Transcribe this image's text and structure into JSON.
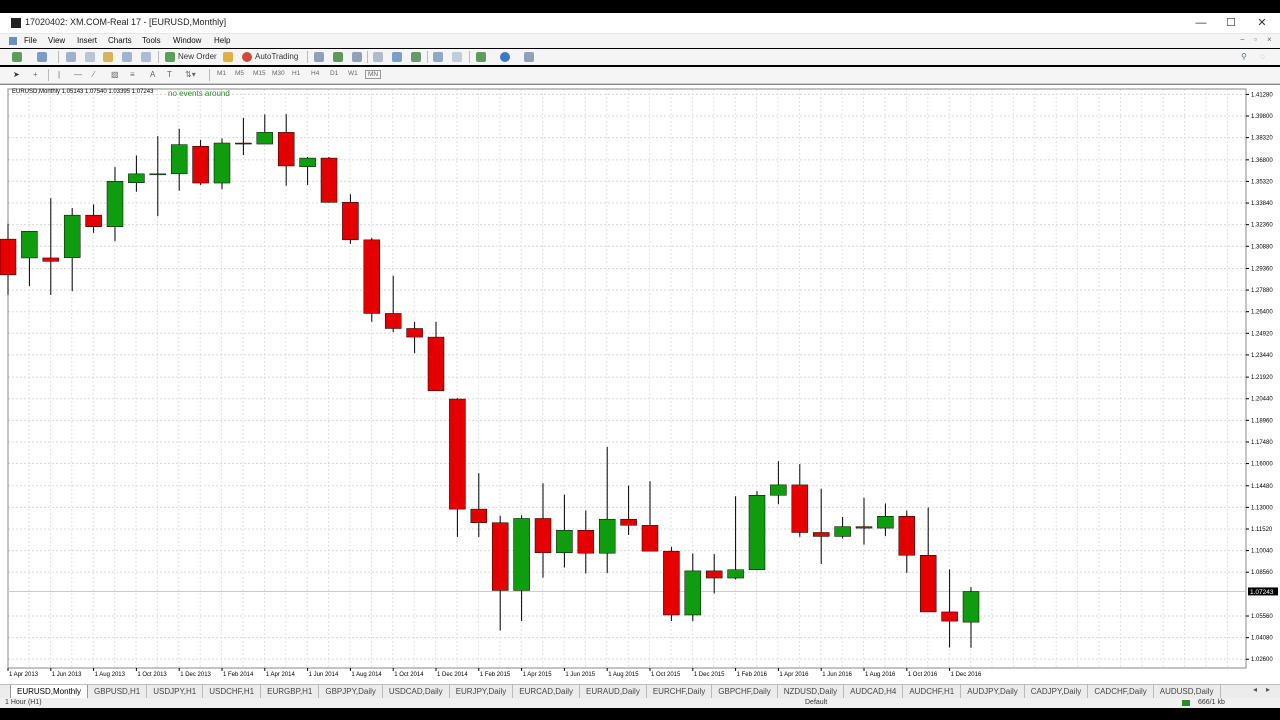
{
  "window": {
    "title": "17020402: XM.COM-Real 17 - [EURUSD,Monthly]",
    "minimize": "—",
    "maximize": "☐",
    "close": "✕"
  },
  "menu": {
    "items": [
      "File",
      "View",
      "Insert",
      "Charts",
      "Tools",
      "Window",
      "Help"
    ]
  },
  "toolbar": {
    "new_order": "New Order",
    "autotrading": "AutoTrading",
    "timeframes": [
      "M1",
      "M5",
      "M15",
      "M30",
      "H1",
      "H4",
      "D1",
      "W1",
      "MN"
    ]
  },
  "chart": {
    "info": "EURUSD,Monthly  1.05143 1.07540 1.03395 1.07243",
    "events": "no events around",
    "current_price": "1.07243",
    "up_color": "#0f9d0f",
    "down_color": "#e50000"
  },
  "chart_data": {
    "type": "candlestick",
    "symbol": "EURUSD",
    "timeframe": "Monthly",
    "x_tick_labels": [
      "1 Apr 2013",
      "1 Jun 2013",
      "1 Aug 2013",
      "1 Oct 2013",
      "1 Dec 2013",
      "1 Feb 2014",
      "1 Apr 2014",
      "1 Jun 2014",
      "1 Aug 2014",
      "1 Oct 2014",
      "1 Dec 2014",
      "1 Feb 2015",
      "1 Apr 2015",
      "1 Jun 2015",
      "1 Aug 2015",
      "1 Oct 2015",
      "1 Dec 2015",
      "1 Feb 2016",
      "1 Apr 2016",
      "1 Jun 2016",
      "1 Aug 2016",
      "1 Oct 2016",
      "1 Dec 2016"
    ],
    "y_tick_labels": [
      "1.41280",
      "1.39800",
      "1.38320",
      "1.36800",
      "1.35320",
      "1.33840",
      "1.32360",
      "1.30880",
      "1.29360",
      "1.27880",
      "1.26400",
      "1.24920",
      "1.23440",
      "1.21920",
      "1.20440",
      "1.18960",
      "1.17480",
      "1.16000",
      "1.14480",
      "1.13000",
      "1.11520",
      "1.10040",
      "1.08560",
      "1.07243",
      "1.05560",
      "1.04080",
      "1.02600"
    ],
    "y_ticks": [
      1.4128,
      1.398,
      1.3832,
      1.368,
      1.3532,
      1.3384,
      1.3236,
      1.3088,
      1.2936,
      1.2788,
      1.264,
      1.2492,
      1.2344,
      1.2192,
      1.2044,
      1.1896,
      1.1748,
      1.16,
      1.1448,
      1.13,
      1.1152,
      1.1004,
      1.0856,
      1.0556,
      1.0408,
      1.026
    ],
    "ylim": [
      1.02,
      1.4165
    ],
    "current_price": 1.07243,
    "candles": [
      {
        "o": 1.3137,
        "h": 1.3242,
        "l": 1.2756,
        "c": 1.2892
      },
      {
        "o": 1.3008,
        "h": 1.3111,
        "l": 1.2815,
        "c": 1.3191
      },
      {
        "o": 1.3008,
        "h": 1.3417,
        "l": 1.2755,
        "c": 1.2985
      },
      {
        "o": 1.301,
        "h": 1.335,
        "l": 1.278,
        "c": 1.3301
      },
      {
        "o": 1.3301,
        "h": 1.3375,
        "l": 1.318,
        "c": 1.3222
      },
      {
        "o": 1.3222,
        "h": 1.363,
        "l": 1.3123,
        "c": 1.3533
      },
      {
        "o": 1.3523,
        "h": 1.371,
        "l": 1.3462,
        "c": 1.3584
      },
      {
        "o": 1.3584,
        "h": 1.3842,
        "l": 1.3294,
        "c": 1.3584
      },
      {
        "o": 1.3584,
        "h": 1.3893,
        "l": 1.3468,
        "c": 1.3784
      },
      {
        "o": 1.3773,
        "h": 1.3817,
        "l": 1.3508,
        "c": 1.3521
      },
      {
        "o": 1.3521,
        "h": 1.3827,
        "l": 1.3479,
        "c": 1.3795
      },
      {
        "o": 1.3795,
        "h": 1.3967,
        "l": 1.3713,
        "c": 1.3788
      },
      {
        "o": 1.3788,
        "h": 1.3991,
        "l": 1.379,
        "c": 1.3868
      },
      {
        "o": 1.3868,
        "h": 1.3993,
        "l": 1.3503,
        "c": 1.3638
      },
      {
        "o": 1.3633,
        "h": 1.37,
        "l": 1.3508,
        "c": 1.3692
      },
      {
        "o": 1.3692,
        "h": 1.37,
        "l": 1.3387,
        "c": 1.3389
      },
      {
        "o": 1.3389,
        "h": 1.3444,
        "l": 1.3104,
        "c": 1.3132
      },
      {
        "o": 1.3132,
        "h": 1.3146,
        "l": 1.2571,
        "c": 1.2628
      },
      {
        "o": 1.2628,
        "h": 1.2887,
        "l": 1.25,
        "c": 1.2525
      },
      {
        "o": 1.2525,
        "h": 1.257,
        "l": 1.2356,
        "c": 1.2466
      },
      {
        "o": 1.2466,
        "h": 1.257,
        "l": 1.2099,
        "c": 1.2098
      },
      {
        "o": 1.2042,
        "h": 1.2048,
        "l": 1.1098,
        "c": 1.1288
      },
      {
        "o": 1.1288,
        "h": 1.1534,
        "l": 1.1097,
        "c": 1.1195
      },
      {
        "o": 1.1195,
        "h": 1.1243,
        "l": 1.0457,
        "c": 1.0731
      },
      {
        "o": 1.0731,
        "h": 1.1246,
        "l": 1.0522,
        "c": 1.1224
      },
      {
        "o": 1.1224,
        "h": 1.1465,
        "l": 1.0819,
        "c": 1.0989
      },
      {
        "o": 1.0989,
        "h": 1.1387,
        "l": 1.0888,
        "c": 1.1143
      },
      {
        "o": 1.1143,
        "h": 1.1278,
        "l": 1.0848,
        "c": 1.0986
      },
      {
        "o": 1.0986,
        "h": 1.1714,
        "l": 1.085,
        "c": 1.1219
      },
      {
        "o": 1.1219,
        "h": 1.1449,
        "l": 1.1111,
        "c": 1.1177
      },
      {
        "o": 1.1177,
        "h": 1.1479,
        "l": 1.1067,
        "c": 1.1
      },
      {
        "o": 1.1,
        "h": 1.103,
        "l": 1.0522,
        "c": 1.0563
      },
      {
        "o": 1.0563,
        "h": 1.0984,
        "l": 1.0521,
        "c": 1.0865
      },
      {
        "o": 1.0865,
        "h": 1.098,
        "l": 1.0711,
        "c": 1.0816
      },
      {
        "o": 1.0816,
        "h": 1.1376,
        "l": 1.0806,
        "c": 1.0873
      },
      {
        "o": 1.0873,
        "h": 1.1411,
        "l": 1.0869,
        "c": 1.1383
      },
      {
        "o": 1.1383,
        "h": 1.1616,
        "l": 1.1321,
        "c": 1.1454
      },
      {
        "o": 1.1454,
        "h": 1.1596,
        "l": 1.1098,
        "c": 1.1128
      },
      {
        "o": 1.1128,
        "h": 1.1428,
        "l": 1.0912,
        "c": 1.1101
      },
      {
        "o": 1.1101,
        "h": 1.1234,
        "l": 1.1087,
        "c": 1.1168
      },
      {
        "o": 1.1168,
        "h": 1.1366,
        "l": 1.1045,
        "c": 1.1158
      },
      {
        "o": 1.1158,
        "h": 1.1327,
        "l": 1.1103,
        "c": 1.1239
      },
      {
        "o": 1.1239,
        "h": 1.1278,
        "l": 1.0851,
        "c": 1.0972
      },
      {
        "o": 1.0972,
        "h": 1.1299,
        "l": 1.0583,
        "c": 1.0584
      },
      {
        "o": 1.0584,
        "h": 1.0875,
        "l": 1.034,
        "c": 1.0521
      },
      {
        "o": 1.0514,
        "h": 1.0754,
        "l": 1.0339,
        "c": 1.0724
      }
    ]
  },
  "tabs": [
    "EURUSD,Monthly",
    "GBPUSD,H1",
    "USDJPY,H1",
    "USDCHF,H1",
    "EURGBP,H1",
    "GBPJPY,Daily",
    "USDCAD,Daily",
    "EURJPY,Daily",
    "EURCAD,Daily",
    "EURAUD,Daily",
    "EURCHF,Daily",
    "GBPCHF,Daily",
    "NZDUSD,Daily",
    "AUDCAD,H4",
    "AUDCHF,H1",
    "AUDJPY,Daily",
    "CADJPY,Daily",
    "CADCHF,Daily",
    "AUDUSD,Daily"
  ],
  "status": {
    "left": "1 Hour (H1)",
    "center": "Default",
    "right": "666/1 kb"
  }
}
